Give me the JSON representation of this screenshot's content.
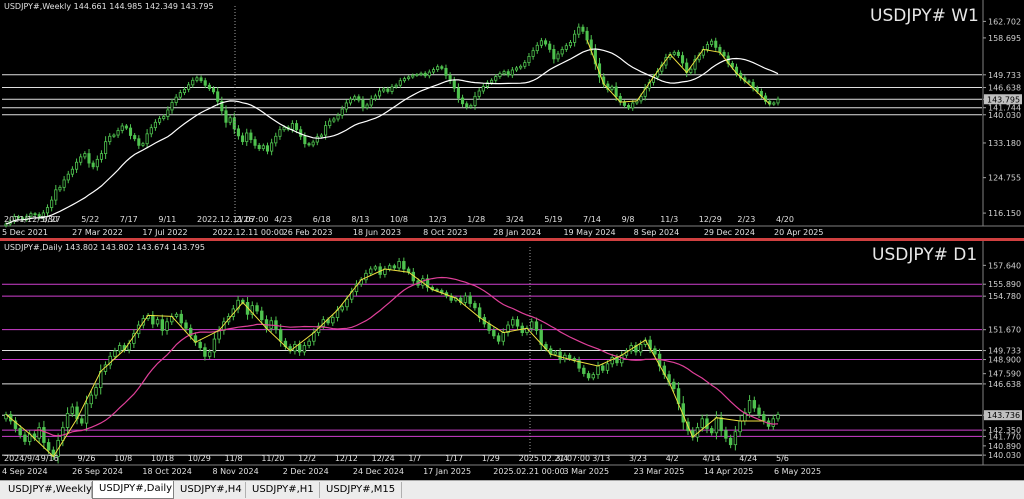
{
  "colors": {
    "background": "#000000",
    "candle": "#4fc24f",
    "weekly_ma": "#ffffff",
    "daily_ma": "#e0409a",
    "zigzag": "#f0e040",
    "hline_white": "#e0e0e0",
    "hline_magenta": "#d040d0",
    "divider": "#d04040"
  },
  "tabs": [
    {
      "label": "USDJPY#,Weekly",
      "active": false
    },
    {
      "label": "USDJPY#,Daily",
      "active": true
    },
    {
      "label": "USDJPY#,H4",
      "active": false
    },
    {
      "label": "USDJPY#,H1",
      "active": false
    },
    {
      "label": "USDJPY#,M15",
      "active": false
    }
  ],
  "chart_data": [
    {
      "type": "candlestick",
      "symbol_label": "USDJPY# W1",
      "info_text": "USDJPY#,Weekly  144.661 144.985 142.349 143.795",
      "ylim": [
        113.5,
        164.5
      ],
      "y_ticks": [
        162.702,
        158.695,
        149.733,
        146.638,
        143.795,
        141.744,
        140.03,
        133.18,
        124.755,
        116.15
      ],
      "current_price": "143.795",
      "hlines": [
        149.733,
        146.638,
        143.795,
        141.744,
        140.03
      ],
      "x_labels": [
        "5 Dec 2021",
        "27 Mar 2022",
        "5/22",
        "17 Jul 2022",
        "9/11",
        "2022.12.11 07:00",
        "2/26",
        "26 Feb 2023",
        "4/23",
        "18 Jun 2023",
        "6/18",
        "8/13",
        "10/8",
        "8 Oct 2023",
        "12/3",
        "1/28",
        "28 Jan 2024",
        "3/24",
        "5/19",
        "19 May 2024",
        "7/14",
        "9/8",
        "8 Sep 2024",
        "11/3",
        "12/29",
        "29 Dec 2024",
        "2/23",
        "4/20",
        "20 Apr 2025"
      ],
      "x_labels_upper": [
        "2021/12/5/30",
        "3/27",
        "5/22",
        "7/17",
        "9/11",
        "2022.12.11 07:00",
        "2/26",
        "4/23",
        "6/18",
        "8/13",
        "10/8",
        "12/3",
        "1/28",
        "3/24",
        "5/19",
        "7/14",
        "9/8",
        "11/3",
        "12/29",
        "2/23",
        "4/20"
      ],
      "x_labels_lower": [
        "5 Dec 2021",
        "27 Mar 2022",
        "17 Jul 2022",
        "2022.12.11 00:00",
        "26 Feb 2023",
        "18 Jun 2023",
        "8 Oct 2023",
        "28 Jan 2024",
        "19 May 2024",
        "8 Sep 2024",
        "29 Dec 2024",
        "20 Apr 2025"
      ],
      "close_series": [
        113.5,
        114.2,
        115.3,
        115.0,
        114.6,
        115.4,
        116.0,
        115.8,
        115.1,
        116.2,
        117.5,
        119.3,
        121.8,
        122.4,
        124.2,
        125.6,
        126.8,
        128.5,
        129.8,
        130.6,
        128.3,
        127.4,
        129.2,
        130.6,
        133.5,
        134.8,
        135.1,
        136.2,
        137.3,
        136.8,
        135.0,
        134.2,
        132.6,
        133.0,
        135.4,
        136.9,
        138.2,
        139.1,
        139.6,
        141.2,
        143.0,
        144.3,
        145.4,
        146.2,
        147.3,
        148.4,
        149.0,
        148.3,
        147.2,
        146.4,
        145.6,
        143.3,
        141.0,
        138.2,
        139.3,
        136.6,
        134.9,
        133.5,
        135.6,
        134.0,
        132.6,
        131.8,
        132.5,
        131.2,
        133.2,
        134.8,
        136.4,
        137.0,
        136.5,
        137.9,
        136.4,
        134.8,
        133.0,
        132.7,
        133.4,
        134.7,
        135.1,
        137.4,
        138.5,
        139.0,
        139.9,
        141.4,
        142.9,
        143.8,
        144.4,
        143.6,
        141.8,
        142.4,
        143.9,
        144.6,
        145.8,
        146.3,
        145.7,
        146.8,
        147.2,
        148.3,
        148.8,
        149.2,
        149.6,
        149.8,
        150.1,
        149.5,
        150.4,
        151.0,
        151.7,
        151.3,
        149.6,
        148.3,
        146.5,
        144.1,
        142.7,
        141.9,
        142.3,
        144.5,
        145.8,
        146.9,
        147.8,
        148.4,
        149.3,
        150.0,
        150.5,
        149.7,
        150.9,
        151.4,
        151.8,
        152.7,
        154.2,
        155.6,
        156.9,
        158.0,
        157.2,
        155.9,
        153.6,
        154.8,
        155.9,
        156.8,
        157.6,
        159.6,
        161.3,
        160.3,
        158.2,
        155.7,
        152.4,
        149.2,
        147.5,
        146.2,
        146.8,
        144.5,
        143.1,
        142.3,
        141.7,
        142.9,
        143.4,
        144.5,
        146.5,
        147.9,
        149.2,
        150.6,
        152.1,
        153.9,
        154.7,
        155.2,
        154.4,
        152.6,
        150.3,
        151.1,
        153.4,
        154.5,
        155.9,
        157.1,
        157.9,
        156.4,
        155.2,
        154.3,
        152.5,
        151.6,
        150.1,
        149.0,
        148.2,
        147.9,
        146.5,
        145.7,
        144.6,
        143.3,
        142.6,
        142.9,
        143.8
      ]
    },
    {
      "type": "candlestick",
      "symbol_label": "USDJPY# D1",
      "info_text": "USDJPY#,Daily  143.802 143.802 143.674 143.795",
      "ylim": [
        139.3,
        158.6
      ],
      "y_ticks": [
        157.64,
        155.89,
        154.78,
        151.67,
        149.733,
        148.9,
        147.59,
        146.638,
        143.736,
        142.35,
        141.77,
        140.89,
        140.03
      ],
      "current_price": "143.736",
      "hlines_white": [
        149.733,
        146.638,
        143.736,
        140.03
      ],
      "hlines_magenta": [
        155.89,
        154.78,
        151.67,
        148.9,
        142.35,
        141.77
      ],
      "x_labels": [
        "4 Sep 2024",
        "9/16",
        "26 Sep 2024",
        "9/26",
        "10/8",
        "18 Oct 2024",
        "10/18",
        "10/29",
        "8 Nov 2024",
        "11/8",
        "11/20",
        "2 Dec 2024",
        "12/2",
        "12/12",
        "24 Dec 2024",
        "12/24",
        "1/7",
        "17 Jan 2025",
        "1/17",
        "1/29",
        "2025.02.21 07:00",
        "2/",
        "3/4",
        "3/13",
        "23 Mar 2025",
        "3/23",
        "4/2",
        "14 Apr 2025",
        "4/14",
        "4/24",
        "6 May 2025",
        "5/6"
      ],
      "x_labels_upper": [
        "2024/9/4",
        "9/16",
        "9/26",
        "10/8",
        "10/18",
        "10/29",
        "11/8",
        "11/20",
        "12/2",
        "12/12",
        "12/24",
        "1/7",
        "1/17",
        "1/29",
        "2025.02.21 07:00",
        "3/4",
        "3/13",
        "3/23",
        "4/2",
        "4/14",
        "4/24",
        "5/6"
      ],
      "x_labels_lower": [
        "4 Sep 2024",
        "26 Sep 2024",
        "18 Oct 2024",
        "8 Nov 2024",
        "2 Dec 2024",
        "24 Dec 2024",
        "17 Jan 2025",
        "2025.02.21 00:00",
        "3 Mar 2025",
        "23 Mar 2025",
        "14 Apr 2025",
        "6 May 2025"
      ],
      "close_series": [
        143.8,
        143.2,
        142.5,
        141.9,
        141.3,
        142.0,
        141.6,
        142.6,
        141.2,
        140.5,
        139.9,
        141.4,
        142.6,
        143.9,
        144.5,
        143.4,
        143.0,
        144.8,
        145.6,
        146.3,
        147.8,
        148.4,
        149.2,
        149.7,
        150.2,
        149.8,
        150.4,
        151.3,
        152.1,
        152.7,
        153.0,
        152.2,
        152.6,
        151.6,
        152.4,
        152.9,
        153.1,
        152.3,
        151.8,
        151.1,
        150.5,
        150.0,
        149.2,
        149.6,
        150.8,
        151.6,
        152.4,
        152.9,
        153.6,
        154.4,
        154.2,
        153.1,
        153.9,
        153.4,
        152.6,
        151.8,
        152.5,
        151.7,
        150.6,
        150.1,
        149.7,
        150.3,
        149.6,
        150.2,
        150.6,
        151.4,
        152.0,
        152.6,
        152.3,
        152.8,
        153.5,
        153.8,
        154.5,
        155.2,
        155.9,
        156.3,
        156.9,
        157.3,
        157.5,
        156.8,
        157.3,
        157.6,
        157.4,
        158.0,
        157.3,
        157.0,
        156.2,
        155.8,
        156.4,
        155.6,
        155.4,
        155.3,
        155.1,
        154.8,
        154.4,
        154.6,
        154.2,
        154.8,
        154.1,
        153.7,
        152.8,
        152.2,
        151.6,
        151.1,
        150.6,
        151.4,
        152.1,
        152.6,
        152.0,
        151.4,
        151.8,
        152.4,
        151.6,
        150.3,
        149.9,
        149.4,
        149.6,
        148.9,
        149.3,
        149.0,
        148.8,
        148.1,
        147.6,
        147.2,
        147.5,
        148.3,
        147.9,
        148.5,
        149.1,
        148.6,
        149.3,
        149.7,
        150.2,
        149.6,
        150.3,
        150.7,
        149.9,
        149.4,
        148.3,
        147.5,
        146.8,
        146.2,
        144.8,
        143.1,
        142.3,
        141.7,
        142.6,
        143.4,
        142.5,
        142.1,
        143.5,
        142.3,
        141.6,
        141.0,
        142.2,
        143.2,
        144.0,
        145.1,
        144.4,
        143.8,
        143.2,
        142.7,
        143.4,
        143.8
      ]
    }
  ]
}
